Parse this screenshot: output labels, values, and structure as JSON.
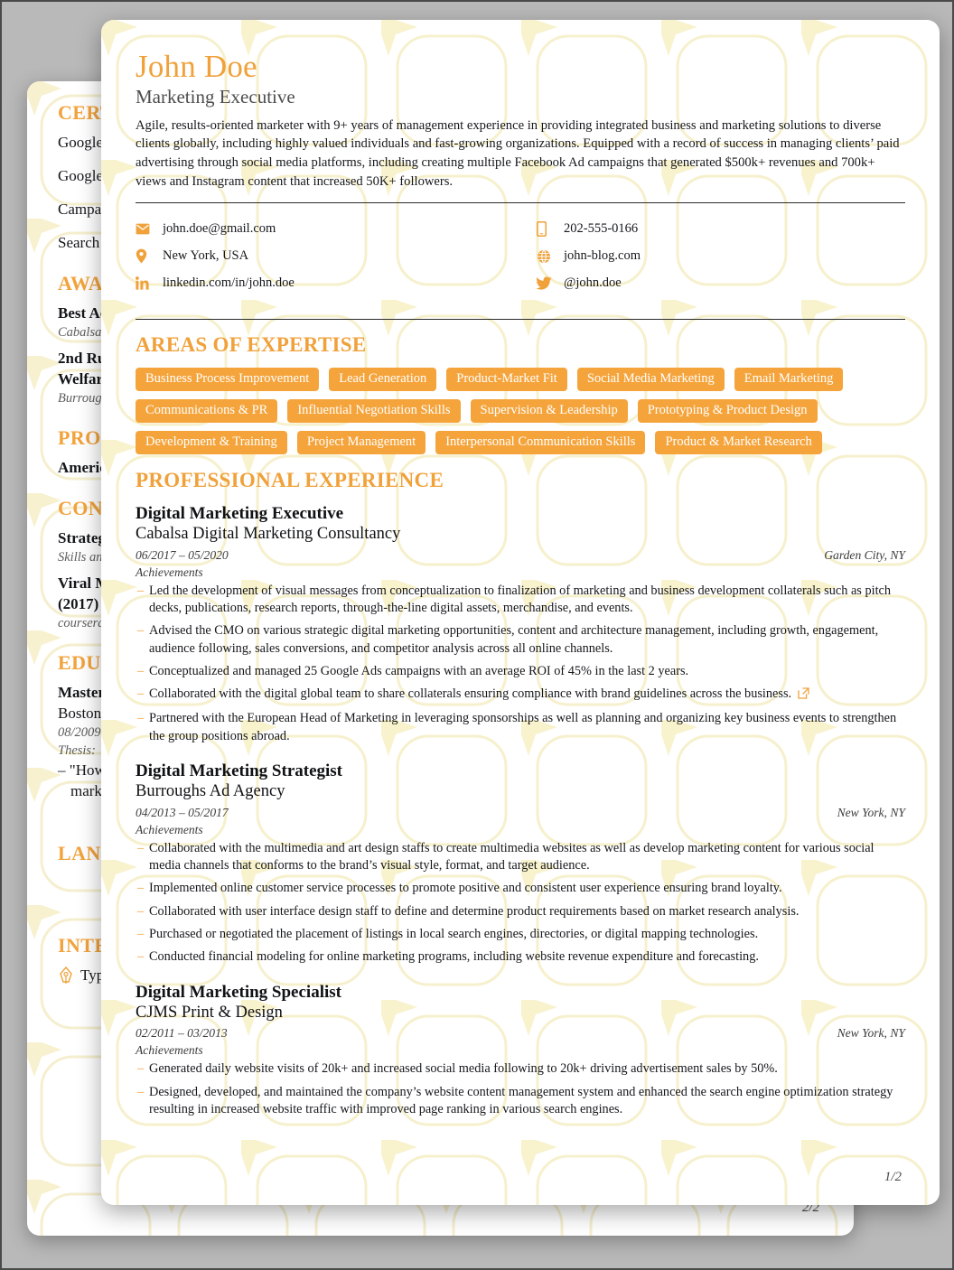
{
  "colors": {
    "accent": "#f0a13a",
    "tag_bg": "#f5a43c",
    "text": "#16171b",
    "muted": "#3c3c3c",
    "page_bg": "#ffffff",
    "canvas_bg": "#b9b9b9"
  },
  "front_page": {
    "name": "John Doe",
    "role": "Marketing Executive",
    "summary": "Agile, results-oriented marketer with 9+ years of management experience in providing integrated business and marketing solutions to diverse clients globally, including highly valued individuals and fast-growing organizations. Equipped with a record of success in managing clients’ paid advertising through social media platforms, including creating multiple Facebook Ad campaigns that generated $500k+ revenues and 700k+ views and Instagram content that increased 50K+ followers.",
    "contacts_left": [
      {
        "icon": "email-icon",
        "value": "john.doe@gmail.com"
      },
      {
        "icon": "location-pin-icon",
        "value": "New York, USA"
      },
      {
        "icon": "linkedin-icon",
        "value": "linkedin.com/in/john.doe"
      }
    ],
    "contacts_right": [
      {
        "icon": "phone-icon",
        "value": "202-555-0166"
      },
      {
        "icon": "globe-icon",
        "value": "john-blog.com"
      },
      {
        "icon": "twitter-icon",
        "value": "@john.doe"
      }
    ],
    "expertise": {
      "heading": "AREAS OF EXPERTISE",
      "tags": [
        "Business Process Improvement",
        "Lead Generation",
        "Product-Market Fit",
        "Social Media Marketing",
        "Email Marketing",
        "Communications & PR",
        "Influential Negotiation Skills",
        "Supervision & Leadership",
        "Prototyping & Product Design",
        "Development & Training",
        "Project Management",
        "Interpersonal Communication Skills",
        "Product & Market Research"
      ]
    },
    "experience": {
      "heading": "PROFESSIONAL EXPERIENCE",
      "achievements_label": "Achievements",
      "jobs": [
        {
          "title": "Digital Marketing Executive",
          "org": "Cabalsa Digital Marketing Consultancy",
          "dates": "06/2017 – 05/2020",
          "location": "Garden City, NY",
          "bullets": [
            {
              "text": "Led the development of visual messages from conceptualization to finalization of marketing and business development collaterals such as pitch decks, publications, research reports, through-the-line digital assets, merchandise, and events.",
              "link": false
            },
            {
              "text": "Advised the CMO on various strategic digital marketing opportunities, content and architecture management, including growth, engagement, audience following, sales conversions, and competitor analysis across all online channels.",
              "link": false
            },
            {
              "text": "Conceptualized and managed 25 Google Ads campaigns with an average ROI of 45% in the last 2 years.",
              "link": false
            },
            {
              "text": "Collaborated with the digital global team to share collaterals ensuring compliance with brand guidelines across the business.",
              "link": true
            },
            {
              "text": "Partnered with the European Head of Marketing in leveraging sponsorships as well as planning and organizing key business events to strengthen the group positions abroad.",
              "link": false
            }
          ]
        },
        {
          "title": "Digital Marketing Strategist",
          "org": "Burroughs Ad Agency",
          "dates": "04/2013 – 05/2017",
          "location": "New York, NY",
          "bullets": [
            {
              "text": "Collaborated with the multimedia and art design staffs to create multimedia websites as well as develop marketing content for various social media channels that conforms to the brand’s visual style, format, and target audience.",
              "link": false
            },
            {
              "text": "Implemented online customer service processes to promote positive and consistent user experience ensuring brand loyalty.",
              "link": false
            },
            {
              "text": "Collaborated with user interface design staff to define and determine product requirements based on market research analysis.",
              "link": false
            },
            {
              "text": "Purchased or negotiated the placement of listings in local search engines, directories, or digital mapping technologies.",
              "link": false
            },
            {
              "text": "Conducted financial modeling for online marketing programs, including website revenue expenditure and forecasting.",
              "link": false
            }
          ]
        },
        {
          "title": "Digital Marketing Specialist",
          "org": "CJMS Print & Design",
          "dates": "02/2011 – 03/2013",
          "location": "New York, NY",
          "bullets": [
            {
              "text": "Generated daily website visits of 20k+ and increased social media following to 20k+ driving advertisement sales by 50%.",
              "link": false
            },
            {
              "text": "Designed, developed, and maintained the company’s website content management system and enhanced the search engine optimization strategy resulting in increased website traffic with improved page ranking in various search engines.",
              "link": false
            }
          ]
        }
      ]
    },
    "page_number": "1/2"
  },
  "back_page": {
    "page_number": "2/2",
    "blocks": [
      {
        "type": "heading",
        "text": "CERT"
      },
      {
        "type": "line",
        "text": "Google",
        "style": "normal"
      },
      {
        "type": "line",
        "text": "Google",
        "style": "normal"
      },
      {
        "type": "line",
        "text": "Campai",
        "style": "normal"
      },
      {
        "type": "line",
        "text": "Search A",
        "style": "normal"
      },
      {
        "type": "heading",
        "text": "AWA"
      },
      {
        "type": "line",
        "text": "Best Ad",
        "style": "bold-tight"
      },
      {
        "type": "line",
        "text": "Cabalsa D",
        "style": "italic"
      },
      {
        "type": "line",
        "text": "2nd Ru",
        "style": "bold-tight"
      },
      {
        "type": "line",
        "text": "Welfare",
        "style": "bold-tight"
      },
      {
        "type": "line",
        "text": "Burroughs",
        "style": "italic"
      },
      {
        "type": "heading",
        "text": "PRO"
      },
      {
        "type": "line",
        "text": "Americ",
        "style": "bold"
      },
      {
        "type": "heading",
        "text": "CON"
      },
      {
        "type": "line",
        "text": "Strategi",
        "style": "bold-tight"
      },
      {
        "type": "line",
        "text": "Skills and",
        "style": "italic"
      },
      {
        "type": "line",
        "text": "Viral M",
        "style": "bold-tight"
      },
      {
        "type": "line",
        "text": "(2017)",
        "style": "bold-tight"
      },
      {
        "type": "line",
        "text": "coursera.",
        "style": "italic"
      },
      {
        "type": "heading",
        "text": "EDU"
      },
      {
        "type": "line",
        "text": "Master",
        "style": "bold-tight"
      },
      {
        "type": "line",
        "text": "Boston",
        "style": "normal-tight"
      },
      {
        "type": "line",
        "text": "08/2009",
        "style": "italic-tight"
      },
      {
        "type": "line",
        "text": "Thesis:",
        "style": "italic-tight"
      },
      {
        "type": "line",
        "text": "–  \"How",
        "style": "normal-tight"
      },
      {
        "type": "line",
        "text": "marke",
        "style": "normal-indent"
      },
      {
        "type": "heading",
        "text": "LAN"
      },
      {
        "type": "heading",
        "text": "INTE"
      },
      {
        "type": "line",
        "text": "Typ",
        "style": "interest"
      }
    ]
  }
}
